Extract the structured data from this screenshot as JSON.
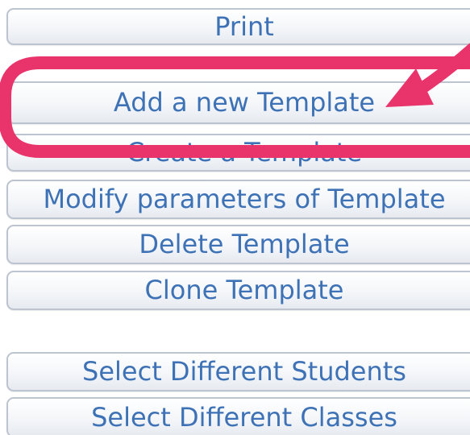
{
  "buttons": {
    "print": "Print",
    "add_template": "Add a new Template",
    "create_template": "Create a Template",
    "modify_template": "Modify parameters of Template",
    "delete_template": "Delete Template",
    "clone_template": "Clone Template",
    "select_students": "Select Different Students",
    "select_classes": "Select Different Classes"
  },
  "annotation": {
    "color": "#e8336b",
    "icon": "arrow-icon"
  }
}
